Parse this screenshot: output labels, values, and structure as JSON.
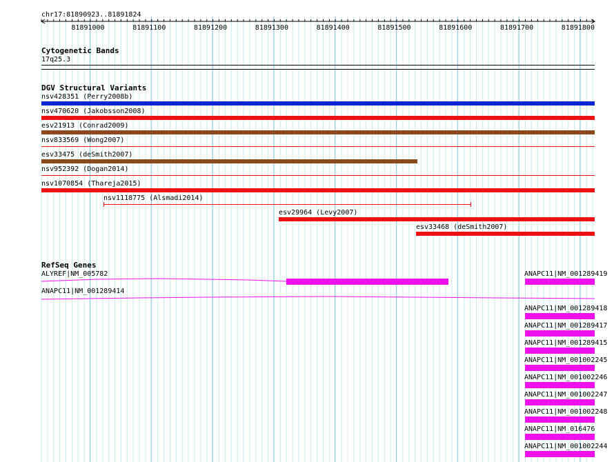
{
  "ruler": {
    "position_label": "chr17:81890923..81891824",
    "ticks": [
      "81891000",
      "81891100",
      "81891200",
      "81891300",
      "81891400",
      "81891500",
      "81891600",
      "81891700",
      "81891800"
    ]
  },
  "tracks": {
    "cytoband": {
      "title": "Cytogenetic Bands",
      "band": "17q25.3"
    },
    "dgv": {
      "title": "DGV Structural Variants",
      "items": [
        {
          "label": "nsv428351 (Perry2008b)",
          "color": "#0b24d6"
        },
        {
          "label": "nsv470620 (Jakobsson2008)",
          "color": "#ee1111"
        },
        {
          "label": "esv21913 (Conrad2009)",
          "color": "#8b4a1e"
        },
        {
          "label": "nsv833569 (Wong2007)",
          "color": "#ee1111"
        },
        {
          "label": "esv33475 (deSmith2007)",
          "color": "#8b4a1e"
        },
        {
          "label": "nsv952392 (Dogan2014)",
          "color": "#ee1111"
        },
        {
          "label": "nsv1070854 (Thareja2015)",
          "color": "#ee1111"
        },
        {
          "label": "nsv1118775 (Alsmadi2014)",
          "color": "#ee1111"
        },
        {
          "label": "esv29964 (Levy2007)",
          "color": "#ee1111"
        },
        {
          "label": "esv33468 (deSmith2007)",
          "color": "#ee1111"
        }
      ]
    },
    "refseq": {
      "title": "RefSeq Genes",
      "gene_color": "#ee11ee",
      "genes": [
        {
          "label": "ALYREF|NM_005782"
        },
        {
          "label": "ANAPC11|NM_001289414"
        }
      ],
      "right_genes": [
        "ANAPC11|NM_001289419",
        "ANAPC11|NM_001289418",
        "ANAPC11|NM_001289417",
        "ANAPC11|NM_001289415",
        "ANAPC11|NM_001002245",
        "ANAPC11|NM_001002246",
        "ANAPC11|NM_001002247",
        "ANAPC11|NM_001002248",
        "ANAPC11|NM_016476",
        "ANAPC11|NM_001002244"
      ]
    }
  }
}
